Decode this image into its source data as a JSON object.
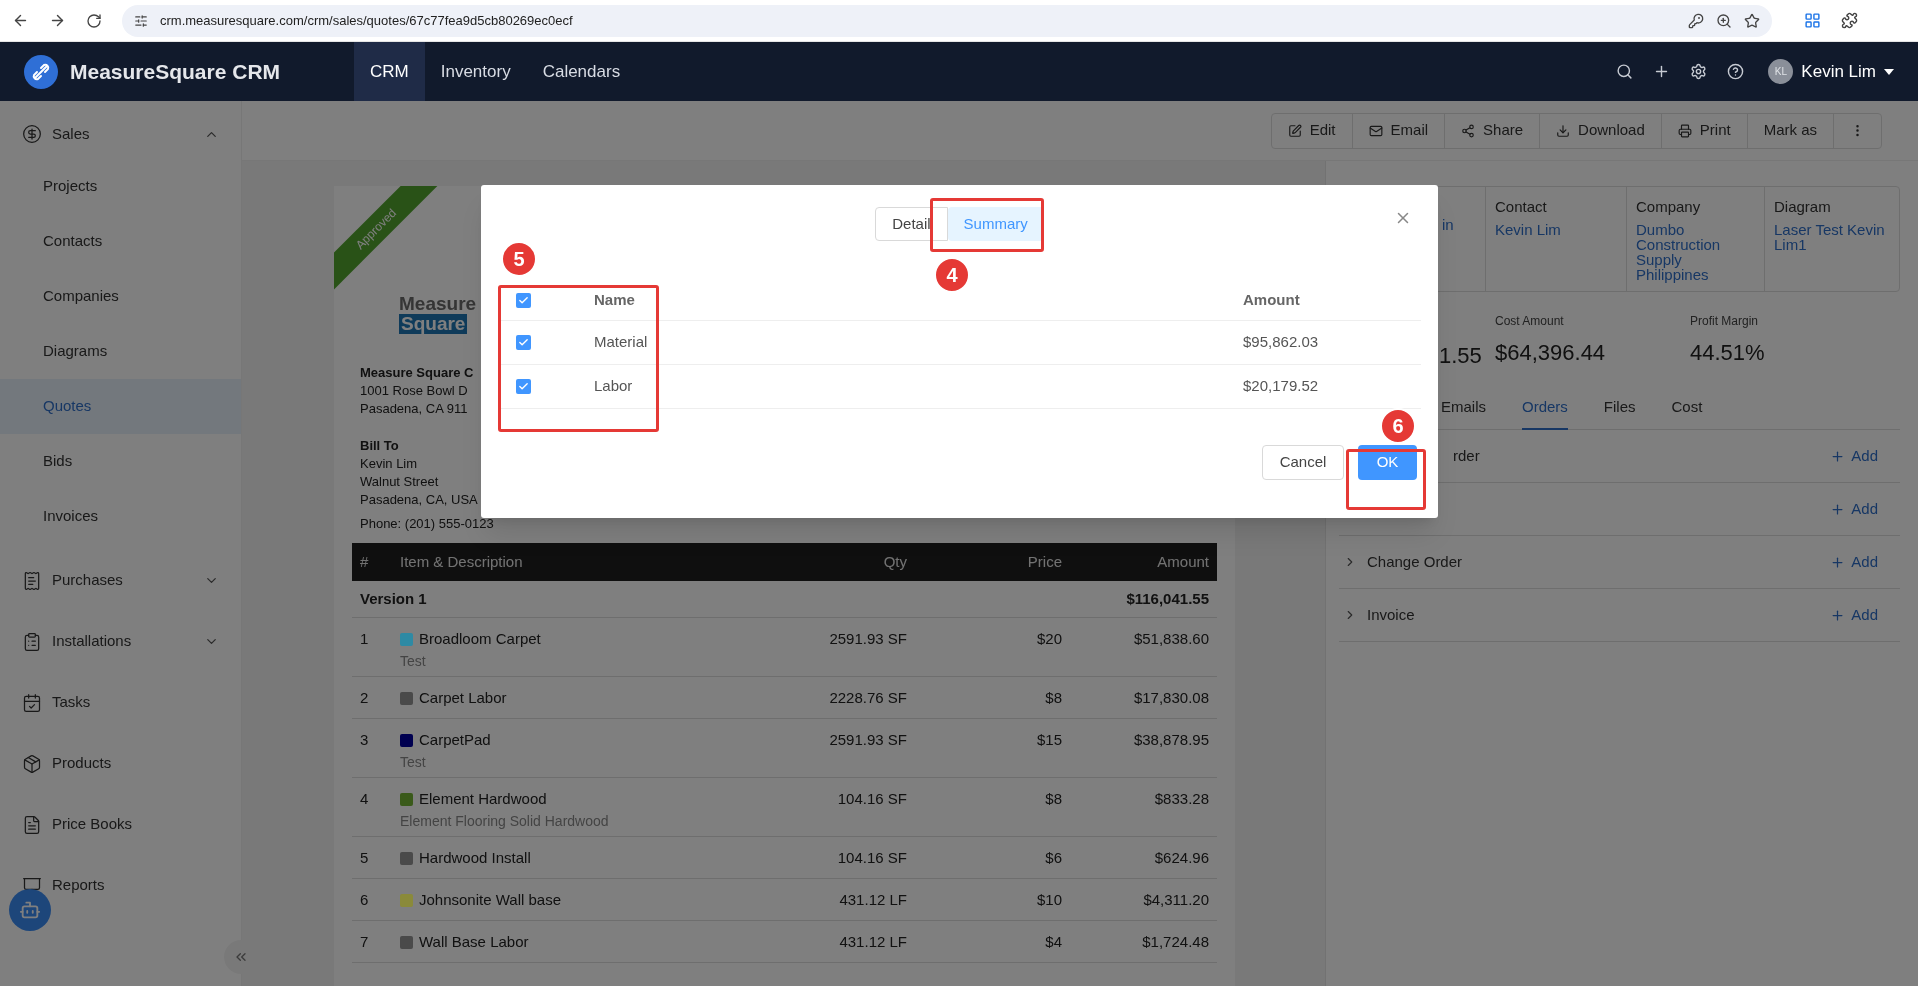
{
  "browser": {
    "url": "crm.measuresquare.com/crm/sales/quotes/67c77fea9d5cb80269ec0ecf"
  },
  "app": {
    "brand": "MeasureSquare CRM",
    "user": {
      "initials": "KL",
      "name": "Kevin Lim"
    }
  },
  "nav": [
    {
      "label": "CRM",
      "selected": true
    },
    {
      "label": "Inventory",
      "selected": false
    },
    {
      "label": "Calendars",
      "selected": false
    }
  ],
  "sidebar": {
    "items": [
      {
        "kind": "group",
        "label": "Sales",
        "expanded": true,
        "children": [
          {
            "label": "Projects",
            "selected": false
          },
          {
            "label": "Contacts",
            "selected": false
          },
          {
            "label": "Companies",
            "selected": false
          },
          {
            "label": "Diagrams",
            "selected": false
          },
          {
            "label": "Quotes",
            "selected": true
          },
          {
            "label": "Bids",
            "selected": false
          },
          {
            "label": "Invoices",
            "selected": false
          }
        ]
      },
      {
        "kind": "group",
        "label": "Purchases",
        "expanded": false
      },
      {
        "kind": "group",
        "label": "Installations",
        "expanded": false
      },
      {
        "kind": "link",
        "label": "Tasks"
      },
      {
        "kind": "link",
        "label": "Products"
      },
      {
        "kind": "link",
        "label": "Price Books"
      },
      {
        "kind": "link",
        "label": "Reports"
      }
    ]
  },
  "toolbar": [
    {
      "kind": "labeled",
      "label": "Edit"
    },
    {
      "kind": "labeled",
      "label": "Email"
    },
    {
      "kind": "labeled",
      "label": "Share"
    },
    {
      "kind": "labeled",
      "label": "Download"
    },
    {
      "kind": "labeled",
      "label": "Print"
    },
    {
      "kind": "labeled",
      "label": "Mark as"
    },
    {
      "kind": "overflow"
    }
  ],
  "document": {
    "stamp": "Approved",
    "logo": {
      "top": "Measure",
      "bottom": "Square"
    },
    "company": {
      "name": "Measure Square C",
      "lines": [
        "1001 Rose Bowl D",
        "Pasadena, CA 911"
      ]
    },
    "bill_to": {
      "heading": "Bill To",
      "lines": [
        "Kevin Lim",
        "Walnut Street",
        "Pasadena, CA, USA",
        "Phone: (201) 555-0123"
      ]
    },
    "table": {
      "columns": [
        "#",
        "Item & Description",
        "Qty",
        "Price",
        "Amount"
      ],
      "group": {
        "label": "Version 1",
        "amount": "$116,041.55"
      },
      "rows": [
        {
          "num": "1",
          "name": "Broadloom Carpet",
          "color": "#2e8aa4",
          "description": "Test",
          "qty": "2591.93 SF",
          "price": "$20",
          "amount": "$51,838.60"
        },
        {
          "num": "2",
          "name": "Carpet Labor",
          "color": "#4a4a4a",
          "qty": "2228.76 SF",
          "price": "$8",
          "amount": "$17,830.08"
        },
        {
          "num": "3",
          "name": "CarpetPad",
          "color": "#000050",
          "description": "Test",
          "qty": "2591.93 SF",
          "price": "$15",
          "amount": "$38,878.95"
        },
        {
          "num": "4",
          "name": "Element Hardwood",
          "color": "#3a5a1a",
          "description": "Element Flooring Solid Hardwood",
          "qty": "104.16 SF",
          "price": "$8",
          "amount": "$833.28"
        },
        {
          "num": "5",
          "name": "Hardwood Install",
          "color": "#4a4a4a",
          "qty": "104.16 SF",
          "price": "$6",
          "amount": "$624.96"
        },
        {
          "num": "6",
          "name": "Johnsonite Wall base",
          "color": "#8a8a3a",
          "qty": "431.12 LF",
          "price": "$10",
          "amount": "$4,311.20"
        },
        {
          "num": "7",
          "name": "Wall Base Labor",
          "color": "#4a4a4a",
          "qty": "431.12 LF",
          "price": "$4",
          "amount": "$1,724.48"
        }
      ]
    }
  },
  "right_panel": {
    "fields": [
      {
        "value": "in"
      },
      {
        "label": "Contact",
        "value": "Kevin Lim"
      },
      {
        "label": "Company",
        "value": "Dumbo Construction Supply Philippines"
      },
      {
        "label": "Diagram",
        "value": "Laser Test Kevin Lim1"
      }
    ],
    "stats": [
      {
        "value": "1.55"
      },
      {
        "label": "Cost Amount",
        "value": "$64,396.44"
      },
      {
        "label": "Profit Margin",
        "value": "44.51%"
      }
    ],
    "tabs": [
      {
        "label": "Emails",
        "selected": false
      },
      {
        "label": "Orders",
        "selected": true
      },
      {
        "label": "Files",
        "selected": false
      },
      {
        "label": "Cost",
        "selected": false
      }
    ],
    "sections": [
      {
        "label": "rder",
        "chevron": false,
        "add": "Add"
      },
      {
        "add": "Add"
      },
      {
        "label": "Change Order",
        "chevron": true,
        "add": "Add"
      },
      {
        "label": "Invoice",
        "chevron": true,
        "add": "Add"
      }
    ]
  },
  "modal": {
    "tabs": [
      {
        "label": "Detail",
        "selected": false
      },
      {
        "label": "Summary",
        "selected": true
      }
    ],
    "columns": [
      "Name",
      "Amount"
    ],
    "all_checked": true,
    "rows": [
      {
        "name": "Material",
        "amount": "$95,862.03",
        "checked": true
      },
      {
        "name": "Labor",
        "amount": "$20,179.52",
        "checked": true
      }
    ],
    "buttons": [
      {
        "kind": "secondary",
        "label": "Cancel"
      },
      {
        "kind": "primary",
        "label": "OK"
      }
    ],
    "annotations": [
      {
        "label": "4"
      },
      {
        "label": "5"
      },
      {
        "label": "6"
      }
    ]
  }
}
